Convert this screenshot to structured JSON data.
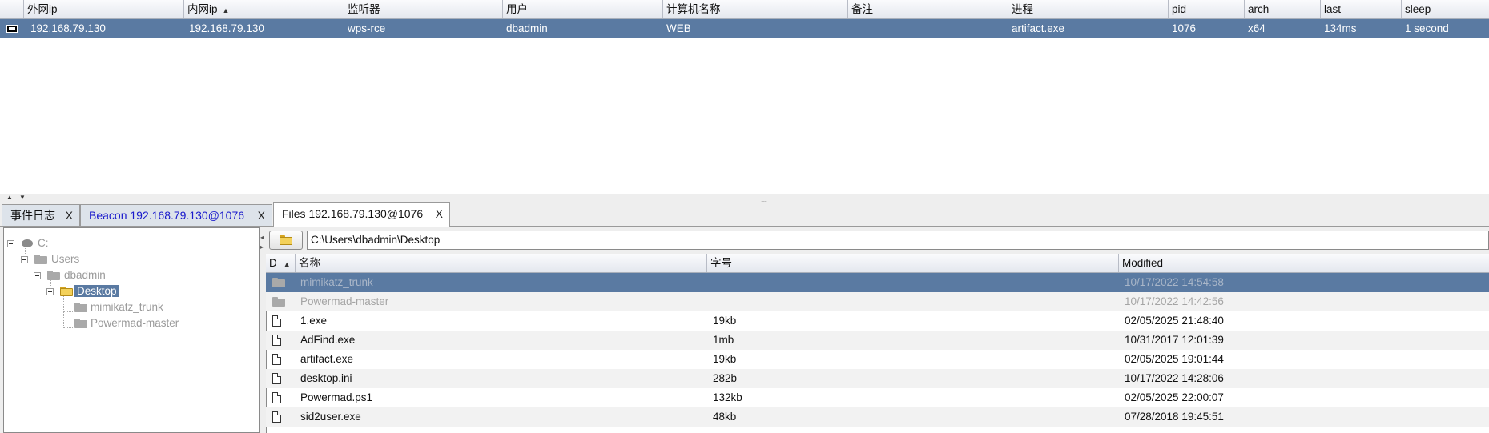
{
  "sessions": {
    "columns": {
      "external_ip": "外网ip",
      "internal_ip": "内网ip",
      "listener": "监听器",
      "user": "用户",
      "computer": "计算机名称",
      "note": "备注",
      "process": "进程",
      "pid": "pid",
      "arch": "arch",
      "last": "last",
      "sleep": "sleep"
    },
    "sort_column": "internal_ip",
    "rows": [
      {
        "external_ip": "192.168.79.130",
        "internal_ip": "192.168.79.130",
        "listener": "wps-rce",
        "user": "dbadmin",
        "computer": "WEB",
        "note": "",
        "process": "artifact.exe",
        "pid": "1076",
        "arch": "x64",
        "last": "134ms",
        "sleep": "1 second"
      }
    ]
  },
  "tabs": [
    {
      "label": "事件日志",
      "close": "X",
      "active": false
    },
    {
      "label": "Beacon 192.168.79.130@1076",
      "close": "X",
      "active": false
    },
    {
      "label": "Files 192.168.79.130@1076",
      "close": "X",
      "active": true
    }
  ],
  "tree": {
    "drive": "C:",
    "users": "Users",
    "user_dir": "dbadmin",
    "selected": "Desktop",
    "children": [
      "mimikatz_trunk",
      "Powermad-master"
    ]
  },
  "path": "C:\\Users\\dbadmin\\Desktop",
  "files": {
    "columns": {
      "type": "D",
      "name": "名称",
      "size": "字号",
      "modified": "Modified"
    },
    "rows": [
      {
        "name": "mimikatz_trunk",
        "size": "",
        "modified": "10/17/2022 14:54:58",
        "is_dir": true,
        "selected": true
      },
      {
        "name": "Powermad-master",
        "size": "",
        "modified": "10/17/2022 14:42:56",
        "is_dir": true,
        "selected": false
      },
      {
        "name": "1.exe",
        "size": "19kb",
        "modified": "02/05/2025 21:48:40",
        "is_dir": false,
        "selected": false
      },
      {
        "name": "AdFind.exe",
        "size": "1mb",
        "modified": "10/31/2017 12:01:39",
        "is_dir": false,
        "selected": false
      },
      {
        "name": "artifact.exe",
        "size": "19kb",
        "modified": "02/05/2025 19:01:44",
        "is_dir": false,
        "selected": false
      },
      {
        "name": "desktop.ini",
        "size": "282b",
        "modified": "10/17/2022 14:28:06",
        "is_dir": false,
        "selected": false
      },
      {
        "name": "Powermad.ps1",
        "size": "132kb",
        "modified": "02/05/2025 22:00:07",
        "is_dir": false,
        "selected": false
      },
      {
        "name": "sid2user.exe",
        "size": "48kb",
        "modified": "07/28/2018 19:45:51",
        "is_dir": false,
        "selected": false
      }
    ]
  },
  "colors": {
    "selection": "#5a7aa2",
    "header_bg": "#e4e7ee",
    "tab_link": "#1a1acc"
  }
}
